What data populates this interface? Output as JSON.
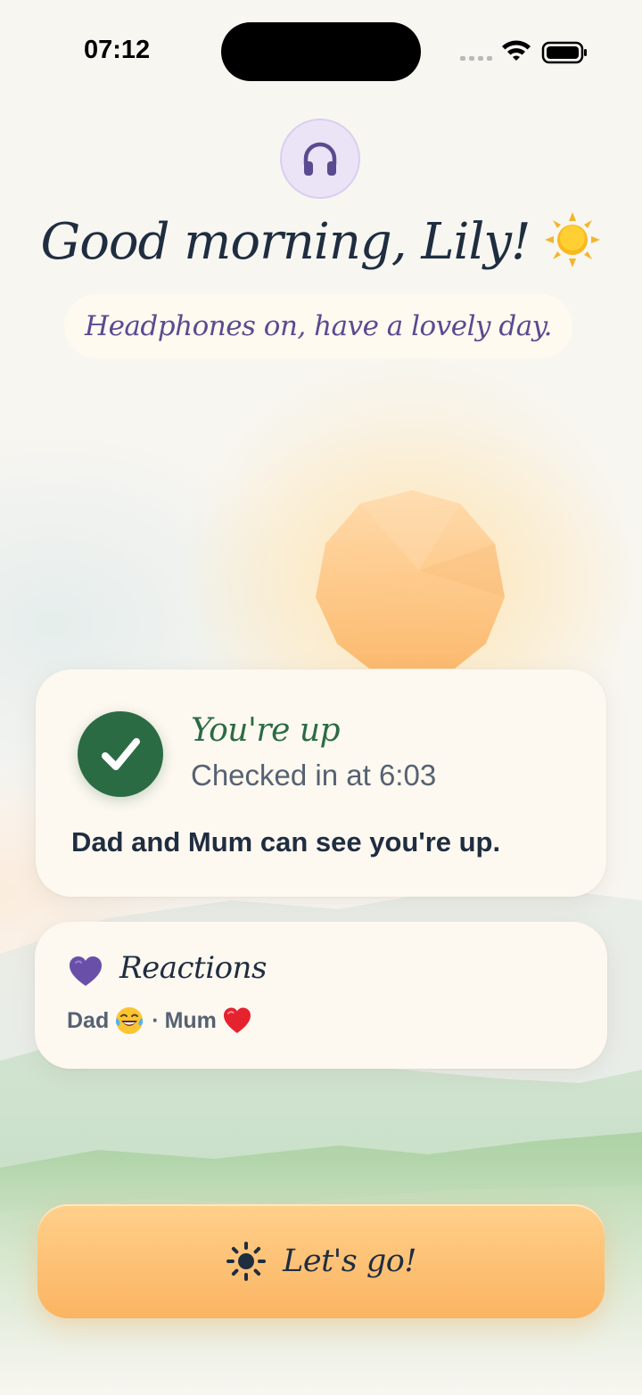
{
  "status_bar": {
    "time": "07:12"
  },
  "header": {
    "avatar_icon": "headphones-icon",
    "greeting": "Good morning, Lily!",
    "greeting_icon": "sun-emoji-icon",
    "subtitle": "Headphones on, have a lovely day."
  },
  "checkin_card": {
    "status_icon": "checkmark-icon",
    "title": "You're up",
    "time_text": "Checked in at 6:03",
    "note": "Dad and Mum can see you're up."
  },
  "reactions_card": {
    "icon": "purple-heart-icon",
    "title": "Reactions",
    "reactions": [
      {
        "name": "Dad",
        "emoji": "laughing-tears-icon"
      },
      {
        "name": "Mum",
        "emoji": "red-heart-icon"
      }
    ],
    "separator": "·"
  },
  "action_button": {
    "icon": "sun-icon",
    "label": "Let's go!"
  },
  "colors": {
    "background": "#f8f6f1",
    "card": "#fdf8f0",
    "accent_green": "#2b6b43",
    "accent_purple": "#5b4a90",
    "button_top": "#ffd08b",
    "button_bottom": "#fbb462",
    "text_dark": "#1f2d40",
    "text_muted": "#566272"
  }
}
